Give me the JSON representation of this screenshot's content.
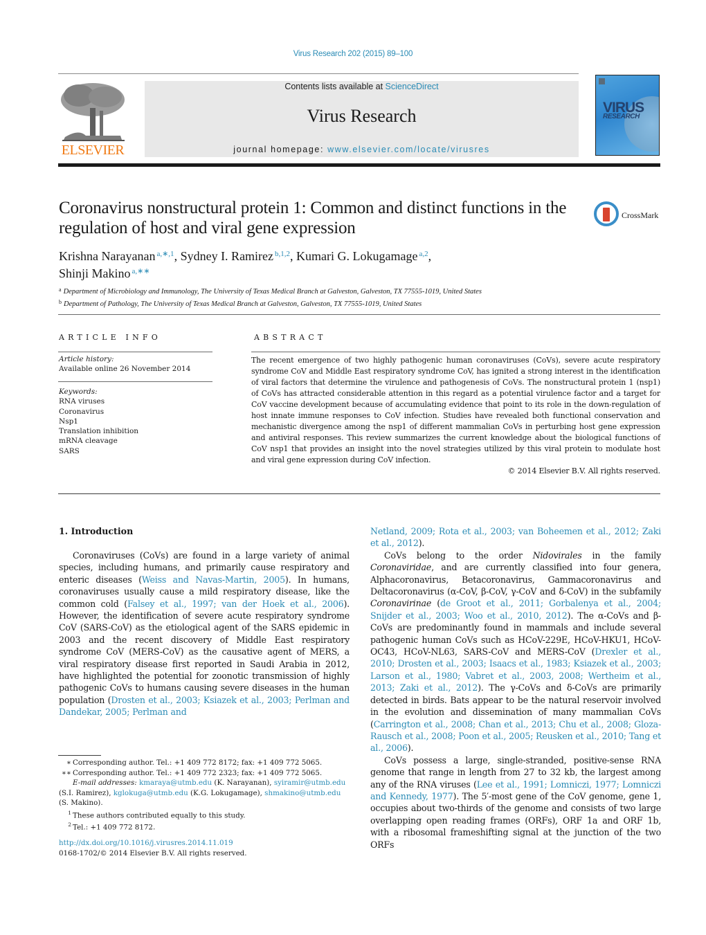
{
  "header": {
    "journal_ref": "Virus Research 202 (2015) 89–100",
    "contents_prefix": "Contents lists available at ",
    "contents_link": "ScienceDirect",
    "journal_title": "Virus Research",
    "homepage_prefix": "journal homepage: ",
    "homepage_link": "www.elsevier.com/locate/virusres",
    "publisher_logo_text": "ELSEVIER",
    "cover_title_1": "VIRUS",
    "cover_title_2": "RESEARCH",
    "crossmark_label": "CrossMark"
  },
  "article": {
    "title": "Coronavirus nonstructural protein 1: Common and distinct functions in the regulation of host and viral gene expression",
    "authors": [
      {
        "name": "Krishna Narayanan",
        "sup": "a,∗,1",
        "sep": ", "
      },
      {
        "name": "Sydney I. Ramirez",
        "sup": "b,1,2",
        "sep": ", "
      },
      {
        "name": "Kumari G. Lokugamage",
        "sup": "a,2",
        "sep": ","
      },
      {
        "name": "Shinji Makino",
        "sup": "a,∗∗",
        "sep": ""
      }
    ],
    "affiliations": [
      {
        "key": "a",
        "text": "Department of Microbiology and Immunology, The University of Texas Medical Branch at Galveston, Galveston, TX 77555-1019, United States"
      },
      {
        "key": "b",
        "text": "Department of Pathology, The University of Texas Medical Branch at Galveston, Galveston, TX 77555-1019, United States"
      }
    ]
  },
  "article_info": {
    "heading": "ARTICLE INFO",
    "history_label": "Article history:",
    "history_value": "Available online 26 November 2014",
    "keywords_label": "Keywords:",
    "keywords": [
      "RNA viruses",
      "Coronavirus",
      "Nsp1",
      "Translation inhibition",
      "mRNA cleavage",
      "SARS"
    ]
  },
  "abstract": {
    "heading": "ABSTRACT",
    "text": "The recent emergence of two highly pathogenic human coronaviruses (CoVs), severe acute respiratory syndrome CoV and Middle East respiratory syndrome CoV, has ignited a strong interest in the identification of viral factors that determine the virulence and pathogenesis of CoVs. The nonstructural protein 1 (nsp1) of CoVs has attracted considerable attention in this regard as a potential virulence factor and a target for CoV vaccine development because of accumulating evidence that point to its role in the down-regulation of host innate immune responses to CoV infection. Studies have revealed both functional conservation and mechanistic divergence among the nsp1 of different mammalian CoVs in perturbing host gene expression and antiviral responses. This review summarizes the current knowledge about the biological functions of CoV nsp1 that provides an insight into the novel strategies utilized by this viral protein to modulate host and viral gene expression during CoV infection.",
    "copyright": "© 2014 Elsevier B.V. All rights reserved."
  },
  "intro": {
    "heading": "1.  Introduction",
    "p1": [
      {
        "t": "Coronaviruses (CoVs) are found in a large variety of animal species, including humans, and primarily cause respiratory and enteric diseases ("
      },
      {
        "l": "Weiss and Navas-Martin, 2005"
      },
      {
        "t": "). In humans, coronaviruses usually cause a mild respiratory disease, like the common cold ("
      },
      {
        "l": "Falsey et al., 1997; van der Hoek et al., 2006"
      },
      {
        "t": "). However, the identification of severe acute respiratory syndrome CoV (SARS-CoV) as the etiological agent of the SARS epidemic in 2003 and the recent discovery of Middle East respiratory syndrome CoV (MERS-CoV) as the causative agent of MERS, a viral respiratory disease first reported in Saudi Arabia in 2012, have highlighted the potential for zoonotic transmission of highly pathogenic CoVs to humans causing severe diseases in the human population ("
      },
      {
        "l": "Drosten et al., 2003; Ksiazek et al., 2003; Perlman and Dandekar, 2005; Perlman and"
      }
    ],
    "p1_cont": [
      {
        "l": "Netland, 2009; Rota et al., 2003; van Boheemen et al., 2012; Zaki et al., 2012"
      },
      {
        "t": ")."
      }
    ],
    "p2": [
      {
        "t": "CoVs belong to the order "
      },
      {
        "i": "Nidovirales"
      },
      {
        "t": " in the family "
      },
      {
        "i": "Coronaviridae"
      },
      {
        "t": ", and are currently classified into four genera, Alphacoronavirus, Betacoronavirus, Gammacoronavirus and Deltacoronavirus (α-CoV, β-CoV, γ-CoV and δ-CoV) in the subfamily "
      },
      {
        "i": "Coronavirinae"
      },
      {
        "t": " ("
      },
      {
        "l": "de Groot et al., 2011; Gorbalenya et al., 2004; Snijder et al., 2003; Woo et al., 2010, 2012"
      },
      {
        "t": "). The α-CoVs and β-CoVs are predominantly found in mammals and include several pathogenic human CoVs such as HCoV-229E, HCoV-HKU1, HCoV-OC43, HCoV-NL63, SARS-CoV and MERS-CoV ("
      },
      {
        "l": "Drexler et al., 2010; Drosten et al., 2003; Isaacs et al., 1983; Ksiazek et al., 2003; Larson et al., 1980; Vabret et al., 2003, 2008; Wertheim et al., 2013; Zaki et al., 2012"
      },
      {
        "t": "). The γ-CoVs and δ-CoVs are primarily detected in birds. Bats appear to be the natural reservoir involved in the evolution and dissemination of many mammalian CoVs ("
      },
      {
        "l": "Carrington et al., 2008; Chan et al., 2013; Chu et al., 2008; Gloza-Rausch et al., 2008; Poon et al., 2005; Reusken et al., 2010; Tang et al., 2006"
      },
      {
        "t": ")."
      }
    ],
    "p3": [
      {
        "t": "CoVs possess a large, single-stranded, positive-sense RNA genome that range in length from 27 to 32 kb, the largest among any of the RNA viruses ("
      },
      {
        "l": "Lee et al., 1991; Lomniczi, 1977; Lomniczi and Kennedy, 1977"
      },
      {
        "t": "). The 5′-most gene of the CoV genome, gene 1, occupies about two-thirds of the genome and consists of two large overlapping open reading frames (ORFs), ORF 1a and ORF 1b, with a ribosomal frameshifting signal at the junction of the two ORFs"
      }
    ]
  },
  "footnotes": {
    "fn1_mark": "∗",
    "fn1": "Corresponding author. Tel.: +1 409 772 8172; fax: +1 409 772 5065.",
    "fn2_mark": "∗∗",
    "fn2": "Corresponding author. Tel.: +1 409 772 2323; fax: +1 409 772 5065.",
    "email_label": "E-mail addresses:",
    "emails": [
      {
        "addr": "kmaraya@utmb.edu",
        "who": " (K. Narayanan), "
      },
      {
        "addr": "syiramir@utmb.edu",
        "who": " (S.I. Ramirez), "
      },
      {
        "addr": "kglokuga@utmb.edu",
        "who": " (K.G. Lokugamage), "
      },
      {
        "addr": "shmakino@utmb.edu",
        "who": " (S. Makino)."
      }
    ],
    "fn3_mark": "1",
    "fn3": "These authors contributed equally to this study.",
    "fn4_mark": "2",
    "fn4": "Tel.: +1 409 772 8172.",
    "doi": "http://dx.doi.org/10.1016/j.virusres.2014.11.019",
    "issn_line": "0168-1702/© 2014 Elsevier B.V. All rights reserved."
  },
  "colors": {
    "link": "#2a8bb5",
    "elsevier_orange": "#f07a14",
    "header_band": "#e8e8e8"
  }
}
